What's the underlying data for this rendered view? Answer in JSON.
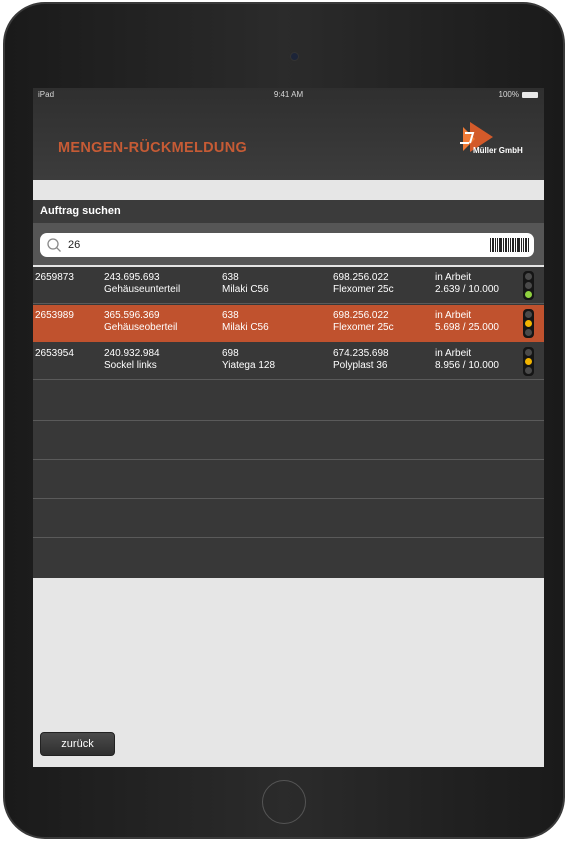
{
  "status_bar": {
    "device": "iPad",
    "time": "9:41 AM",
    "battery": "100%"
  },
  "header": {
    "title": "MENGEN-RÜCKMELDUNG",
    "logo_text": "Müller GmbH"
  },
  "search_section": {
    "title": "Auftrag suchen",
    "query": "26",
    "icons": {
      "search": "search-icon",
      "scan": "barcode-icon"
    }
  },
  "orders": [
    {
      "order": "2659873",
      "article_no": "243.695.693",
      "article": "Gehäuseunterteil",
      "op_no": "638",
      "machine": "Milaki C56",
      "material_no": "698.256.022",
      "material": "Flexomer 25c",
      "status": "in Arbeit",
      "progress": "2.639 / 10.000",
      "signal": "green",
      "selected": false
    },
    {
      "order": "2653989",
      "article_no": "365.596.369",
      "article": "Gehäuseoberteil",
      "op_no": "638",
      "machine": "Milaki C56",
      "material_no": "698.256.022",
      "material": "Flexomer 25c",
      "status": "in Arbeit",
      "progress": "5.698 / 25.000",
      "signal": "yellow",
      "selected": true
    },
    {
      "order": "2653954",
      "article_no": "240.932.984",
      "article": "Sockel links",
      "op_no": "698",
      "machine": "Yiatega 128",
      "material_no": "674.235.698",
      "material": "Polyplast 36",
      "status": "in Arbeit",
      "progress": "8.956 / 10.000",
      "signal": "yellow",
      "selected": false
    }
  ],
  "footer": {
    "back_label": "zurück"
  },
  "colors": {
    "accent": "#c65b35",
    "selected_row": "#c0522e",
    "signal_green": "#8fd13f",
    "signal_yellow": "#f2b400"
  }
}
